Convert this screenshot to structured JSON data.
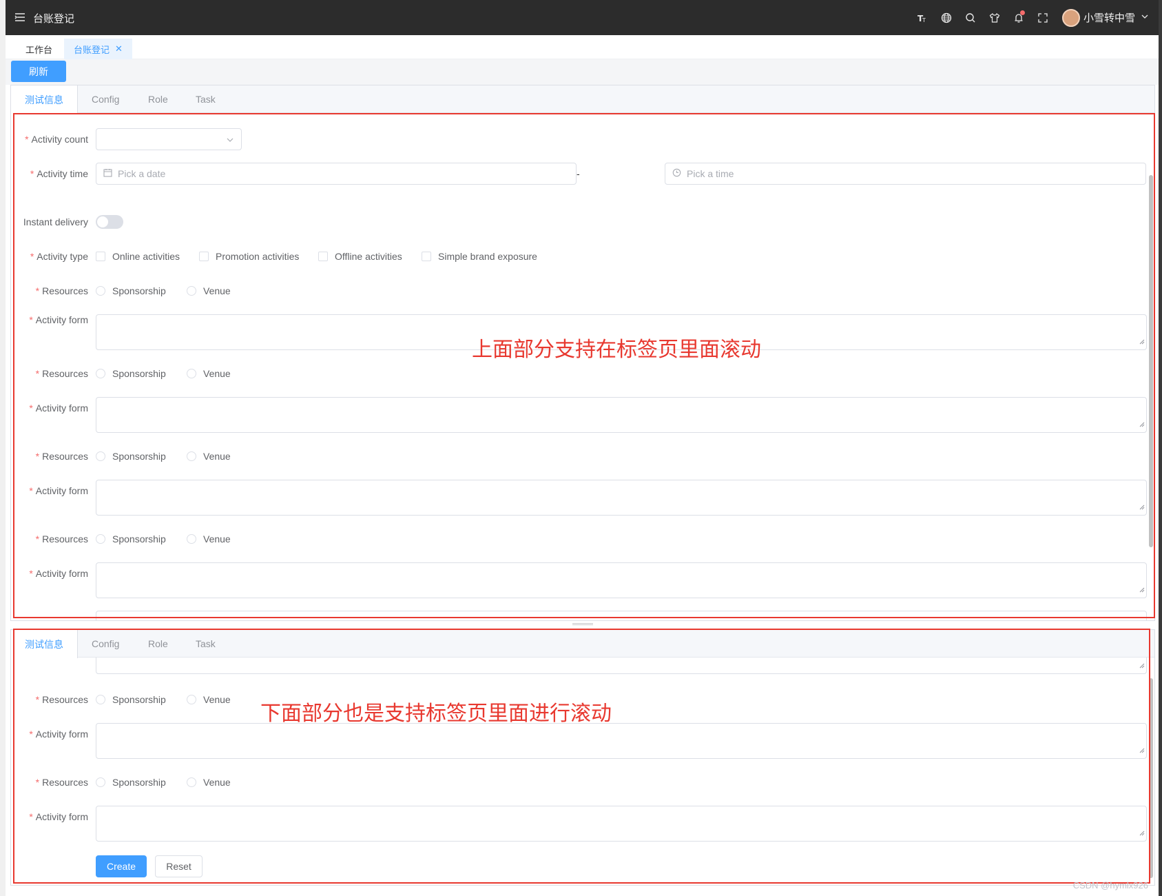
{
  "app": {
    "title": "台账登记"
  },
  "user": {
    "name": "小雪转中雪"
  },
  "topbar_icons": [
    "font-size-icon",
    "globe-icon",
    "search-icon",
    "shirt-icon",
    "bell-icon",
    "fullscreen-icon",
    "chevron-down-icon"
  ],
  "page_tabs": [
    {
      "label": "工作台"
    },
    {
      "label": "台账登记"
    }
  ],
  "toolbar": {
    "refresh_label": "刷新"
  },
  "tabs": [
    {
      "label": "测试信息"
    },
    {
      "label": "Config"
    },
    {
      "label": "Role"
    },
    {
      "label": "Task"
    }
  ],
  "form": {
    "activity_count_label": "Activity count",
    "activity_time_label": "Activity time",
    "date_placeholder": "Pick a date",
    "time_placeholder": "Pick a time",
    "range_separator": "-",
    "instant_delivery_label": "Instant delivery",
    "activity_type_label": "Activity type",
    "activity_types": [
      "Online activities",
      "Promotion activities",
      "Offline activities",
      "Simple brand exposure"
    ],
    "resources_label": "Resources",
    "resource_options": [
      "Sponsorship",
      "Venue"
    ],
    "activity_form_label": "Activity form",
    "create_label": "Create",
    "reset_label": "Reset"
  },
  "annotations": {
    "top": "上面部分支持在标签页里面滚动",
    "bottom": "下面部分也是支持标签页里面进行滚动"
  },
  "watermark": "CSDN @hymlx926",
  "colors": {
    "primary": "#409eff",
    "required": "#f56c6c",
    "annotation": "#e8382f",
    "topbar": "#2c2c2c"
  }
}
